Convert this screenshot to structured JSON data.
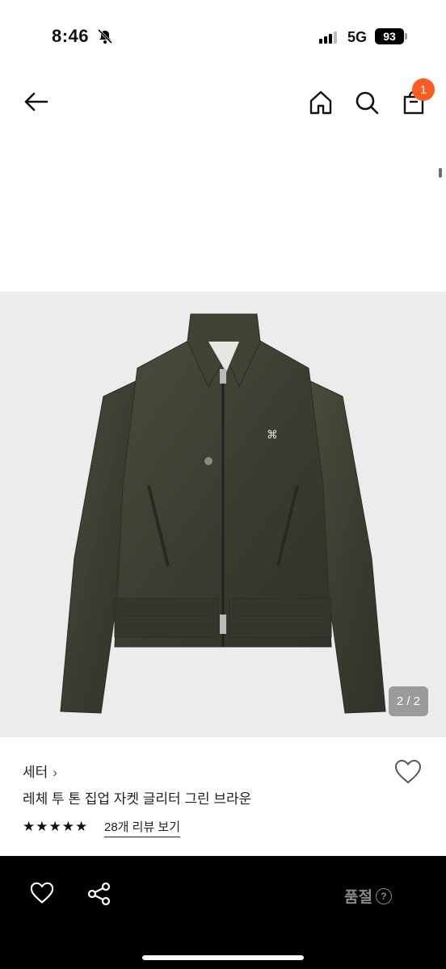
{
  "status_bar": {
    "time": "8:46",
    "network": "5G",
    "battery": "93"
  },
  "header": {
    "cart_badge": "1",
    "icons": [
      "back-arrow-icon",
      "home-icon",
      "search-icon",
      "shopping-bag-icon"
    ]
  },
  "gallery": {
    "pager": "2 / 2"
  },
  "product": {
    "brand": "세터",
    "brand_chevron": "›",
    "title": "레체 투 톤 집업 자켓 글리터 그린 브라운",
    "stars": "★★★★★",
    "rating": 5,
    "reviews_link": "28개 리뷰 보기"
  },
  "bottom_bar": {
    "sold_out": "품절",
    "help_glyph": "?"
  },
  "colors": {
    "badge": "#ff5a1f",
    "jacket": "#3b3f30",
    "image_bg": "#ececec"
  }
}
